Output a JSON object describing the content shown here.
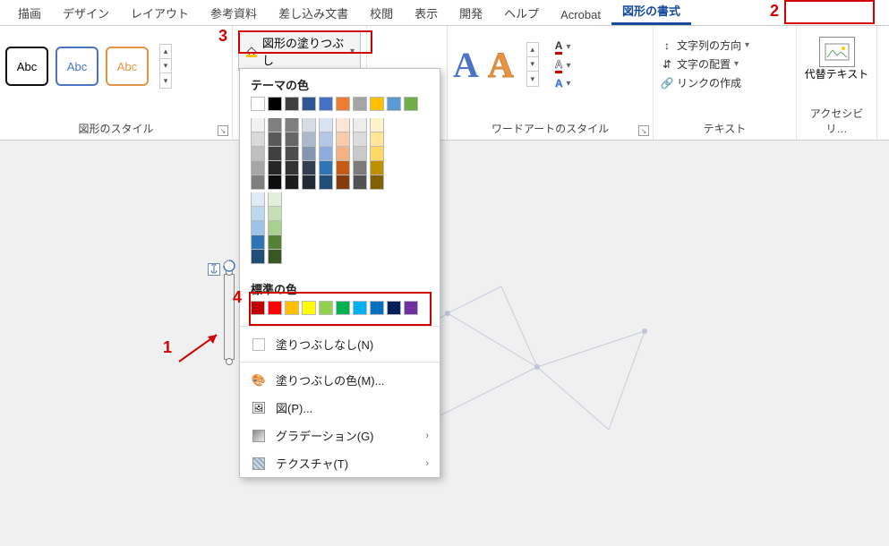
{
  "tabs": [
    "描画",
    "デザイン",
    "レイアウト",
    "参考資料",
    "差し込み文書",
    "校閲",
    "表示",
    "開発",
    "ヘルプ",
    "Acrobat",
    "図形の書式"
  ],
  "active_tab_index": 10,
  "annotations": {
    "n1": "1",
    "n2": "2",
    "n3": "3",
    "n4": "4"
  },
  "shape_samples": {
    "label": "Abc"
  },
  "group_labels": {
    "shape_styles": "図形のスタイル",
    "wordart_styles": "ワードアートのスタイル",
    "text": "テキスト",
    "accessibility": "アクセシビリ…"
  },
  "ribbon_buttons": {
    "shape_fill": "図形の塗りつぶし",
    "text_direction": "文字列の方向",
    "text_align": "文字の配置",
    "create_link": "リンクの作成",
    "alt_text": "代替テキスト"
  },
  "menu": {
    "theme_colors_title": "テーマの色",
    "standard_colors_title": "標準の色",
    "no_fill": "塗りつぶしなし(N)",
    "more_colors": "塗りつぶしの色(M)...",
    "picture": "図(P)...",
    "gradient": "グラデーション(G)",
    "texture": "テクスチャ(T)",
    "theme_row_top": [
      "#ffffff",
      "#000000",
      "#404040",
      "#2f5597",
      "#4472c4",
      "#ed7d31",
      "#a5a5a5",
      "#ffc000",
      "#5b9bd5",
      "#70ad47"
    ],
    "theme_shades": [
      [
        "#f2f2f2",
        "#808080",
        "#7f7f7f",
        "#d6dce5",
        "#d9e2f3",
        "#fbe5d6",
        "#ededed",
        "#fff2cc",
        "#deebf7",
        "#e2f0d9"
      ],
      [
        "#d9d9d9",
        "#595959",
        "#666666",
        "#adb9ca",
        "#b4c7e7",
        "#f8cbad",
        "#dbdbdb",
        "#ffe699",
        "#bdd7ee",
        "#c5e0b4"
      ],
      [
        "#bfbfbf",
        "#404040",
        "#4d4d4d",
        "#8497b0",
        "#8faadc",
        "#f4b183",
        "#c9c9c9",
        "#ffd966",
        "#9dc3e6",
        "#a9d18e"
      ],
      [
        "#a6a6a6",
        "#262626",
        "#333333",
        "#333f50",
        "#2e75b6",
        "#c55a11",
        "#7b7b7b",
        "#bf9000",
        "#2e75b6",
        "#548235"
      ],
      [
        "#7f7f7f",
        "#0d0d0d",
        "#1a1a1a",
        "#222a35",
        "#1f4e79",
        "#843c0c",
        "#525252",
        "#806000",
        "#1f4e79",
        "#385723"
      ]
    ],
    "standard_colors": [
      "#c00000",
      "#ff0000",
      "#ffc000",
      "#ffff00",
      "#92d050",
      "#00b050",
      "#00b0f0",
      "#0070c0",
      "#002060",
      "#7030a0"
    ]
  }
}
